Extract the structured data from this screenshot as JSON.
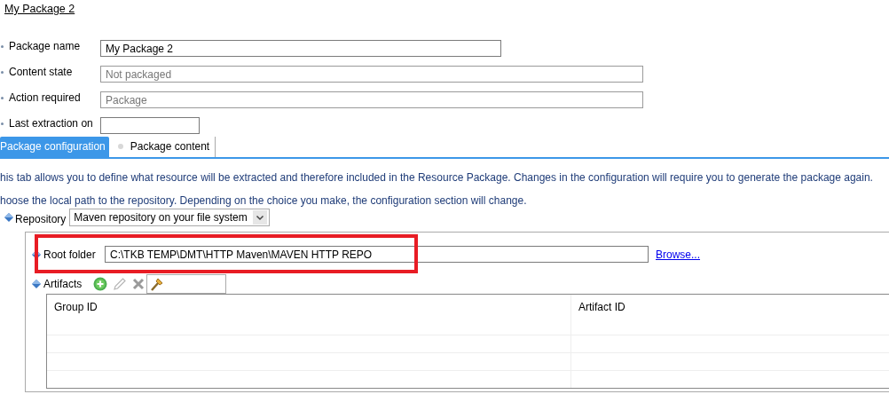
{
  "title": "My Package 2",
  "fields": [
    {
      "label": "Package name",
      "value": "My Package 2",
      "disabled": false
    },
    {
      "label": "Content state",
      "value": "Not packaged",
      "disabled": true
    },
    {
      "label": "Action required",
      "value": "Package",
      "disabled": true
    },
    {
      "label": "Last extraction on",
      "disabled": false
    }
  ],
  "tabs": [
    {
      "label": "Package configuration",
      "selected": true
    },
    {
      "label": "Package content",
      "selected": false
    }
  ],
  "descriptions": [
    "his tab allows you to define what resource will be extracted and therefore included in the Resource Package. Changes in the configuration will require you to generate the package again.",
    "hoose the local path to the repository. Depending on the choice you make, the configuration section will change."
  ],
  "repository": {
    "label": "Repository",
    "value": "Maven repository on your file system"
  },
  "root_folder": {
    "label": "Root folder",
    "value": "C:\\TKB TEMP\\DMT\\HTTP Maven\\MAVEN HTTP REPO",
    "link": "Browse...",
    "highlighted": true
  },
  "artifacts": {
    "label": "Artifacts",
    "table": {
      "columns": [
        "Group ID",
        "Artifact ID"
      ]
    }
  }
}
